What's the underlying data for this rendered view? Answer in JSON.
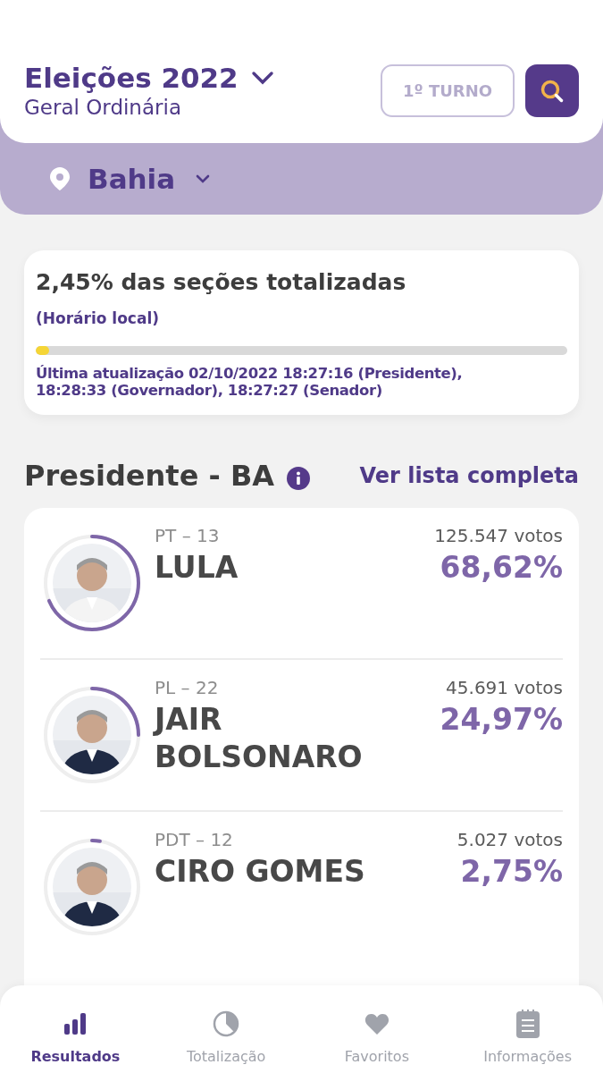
{
  "header": {
    "title": "Eleições 2022",
    "subtitle": "Geral Ordinária",
    "round_button": "1º TURNO"
  },
  "location": {
    "name": "Bahia"
  },
  "progress_card": {
    "title": "2,45% das seções totalizadas",
    "note": "(Horário local)",
    "level": 0.0245,
    "updated": "Última atualização 02/10/2022 18:27:16 (Presidente), 18:28:33 (Governador), 18:27:27 (Senador)"
  },
  "section": {
    "title": "Presidente - BA",
    "link": "Ver lista completa"
  },
  "candidates": [
    {
      "party": "PT – 13",
      "name": "LULA",
      "votes": "125.547 votos",
      "percent": "68,62%"
    },
    {
      "party": "PL – 22",
      "name": "JAIR BOLSONARO",
      "votes": "45.691 votos",
      "percent": "24,97%"
    },
    {
      "party": "PDT – 12",
      "name": "CIRO GOMES",
      "votes": "5.027 votos",
      "percent": "2,75%"
    }
  ],
  "bottom_nav": [
    {
      "label": "Resultados",
      "kind": "bars",
      "selected": true
    },
    {
      "label": "Totalização",
      "kind": "pie",
      "selected": false
    },
    {
      "label": "Favoritos",
      "kind": "heart",
      "selected": false
    },
    {
      "label": "Informações",
      "kind": "notepad",
      "selected": false
    }
  ]
}
